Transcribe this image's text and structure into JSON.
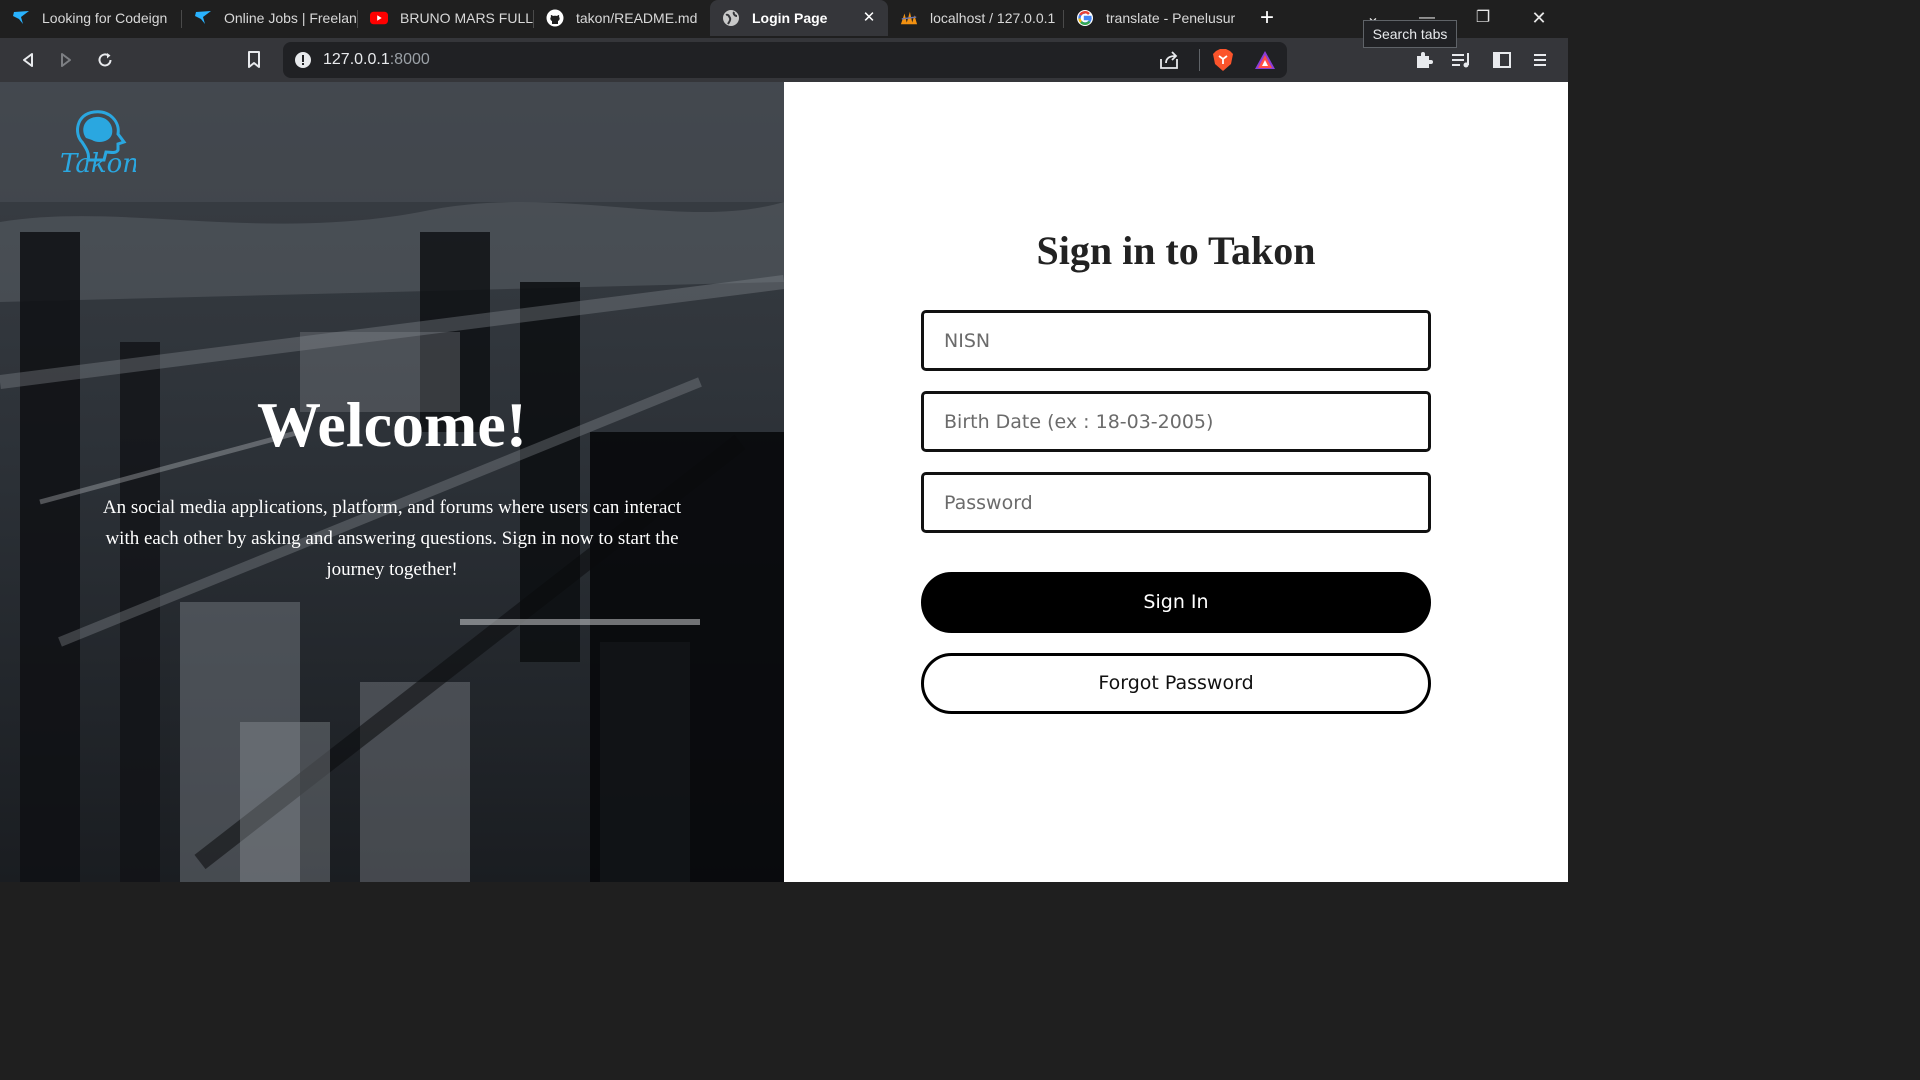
{
  "browser": {
    "tabs": [
      {
        "title": "Looking for Codeign",
        "icon": "freelancer-icon",
        "active": false
      },
      {
        "title": "Online Jobs | Freelan",
        "icon": "freelancer-icon",
        "active": false
      },
      {
        "title": "BRUNO MARS FULL",
        "icon": "youtube-icon",
        "active": false
      },
      {
        "title": "takon/README.md",
        "icon": "github-icon",
        "active": false
      },
      {
        "title": "Login Page",
        "icon": "globe-icon",
        "active": true
      },
      {
        "title": "localhost / 127.0.0.1",
        "icon": "phpmyadmin-icon",
        "active": false
      },
      {
        "title": "translate - Penelusur",
        "icon": "google-icon",
        "active": false
      }
    ],
    "tooltip": "Search tabs",
    "address": {
      "host": "127.0.0.1",
      "port": ":8000"
    },
    "colors": {
      "tabstrip": "#1f1f1f",
      "toolbar": "#35363a",
      "brave": "#fb542b"
    }
  },
  "page": {
    "left_panel": {
      "logo_text": "Takon",
      "heading": "Welcome!",
      "intro": "An social media applications, platform, and forums where users can interact with each other by asking and answering questions. Sign in now to start the journey together!"
    },
    "form": {
      "title": "Sign in to Takon",
      "nisn_placeholder": "NISN",
      "birthdate_placeholder": "Birth Date (ex : 18-03-2005)",
      "password_placeholder": "Password",
      "signin_label": "Sign In",
      "forgot_label": "Forgot Password"
    },
    "colors": {
      "accent_logo": "#2aa7e0",
      "button": "#000000"
    }
  }
}
